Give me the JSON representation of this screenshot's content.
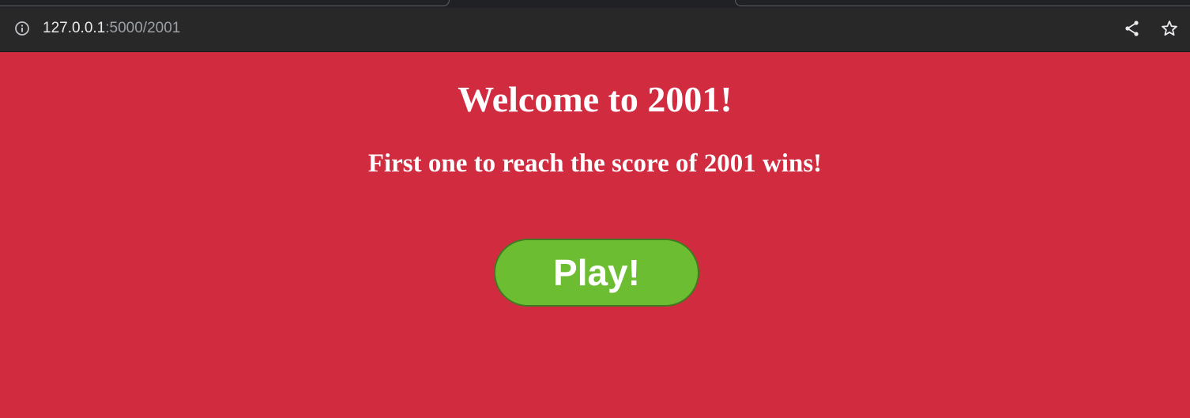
{
  "browser": {
    "url_host": "127.0.0.1",
    "url_rest": ":5000/2001"
  },
  "page": {
    "title": "Welcome to 2001!",
    "subtitle": "First one to reach the score of 2001 wins!",
    "play_label": "Play!"
  },
  "colors": {
    "background": "#d12b40",
    "button": "#6dbd33",
    "text": "#ffffff"
  },
  "icons": {
    "info": "info-icon",
    "share": "share-icon",
    "bookmark": "star-icon"
  }
}
